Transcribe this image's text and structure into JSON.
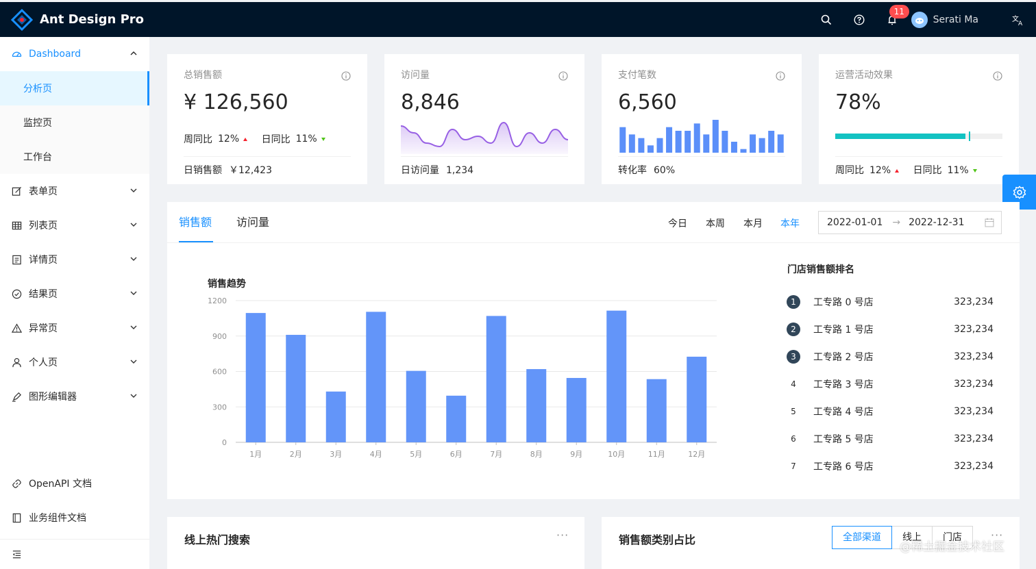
{
  "header": {
    "title": "Ant Design Pro",
    "notification_count": "11",
    "user_name": "Serati Ma",
    "lang_glyph": "文A"
  },
  "sider": {
    "dashboard": {
      "label": "Dashboard",
      "children": [
        "分析页",
        "监控页",
        "工作台"
      ]
    },
    "items": [
      "表单页",
      "列表页",
      "详情页",
      "结果页",
      "异常页",
      "个人页",
      "图形编辑器"
    ],
    "bottom": [
      "OpenAPI 文档",
      "业务组件文档"
    ]
  },
  "stats": [
    {
      "title": "总销售额",
      "value": "¥ 126,560",
      "foot_label": "日销售额",
      "foot_value": "￥12,423",
      "trends": [
        {
          "label": "周同比",
          "value": "12%",
          "dir": "up"
        },
        {
          "label": "日同比",
          "value": "11%",
          "dir": "down"
        }
      ]
    },
    {
      "title": "访问量",
      "value": "8,846",
      "foot_label": "日访问量",
      "foot_value": "1,234",
      "area_values": [
        7,
        5,
        2,
        1,
        6,
        3,
        4,
        2,
        8,
        1,
        5,
        2,
        6,
        3
      ]
    },
    {
      "title": "支付笔数",
      "value": "6,560",
      "foot_label": "转化率",
      "foot_value": "60%",
      "bar_values": [
        7,
        5,
        4,
        2,
        4,
        7,
        6,
        6,
        8,
        5,
        9,
        6,
        3,
        1,
        5,
        4,
        6,
        5
      ]
    },
    {
      "title": "运营活动效果",
      "value": "78%",
      "progress": 78,
      "target": 80,
      "trends": [
        {
          "label": "周同比",
          "value": "12%",
          "dir": "up"
        },
        {
          "label": "日同比",
          "value": "11%",
          "dir": "down"
        }
      ]
    }
  ],
  "sales": {
    "tabs": [
      "销售额",
      "访问量"
    ],
    "ranges": [
      "今日",
      "本周",
      "本月",
      "本年"
    ],
    "active_range": "本年",
    "date_start": "2022-01-01",
    "date_end": "2022-12-31",
    "chart_title": "销售趋势",
    "rank_title": "门店销售额排名",
    "rank": [
      {
        "no": "1",
        "name": "工专路 0 号店",
        "value": "323,234"
      },
      {
        "no": "2",
        "name": "工专路 1 号店",
        "value": "323,234"
      },
      {
        "no": "3",
        "name": "工专路 2 号店",
        "value": "323,234"
      },
      {
        "no": "4",
        "name": "工专路 3 号店",
        "value": "323,234"
      },
      {
        "no": "5",
        "name": "工专路 4 号店",
        "value": "323,234"
      },
      {
        "no": "6",
        "name": "工专路 5 号店",
        "value": "323,234"
      },
      {
        "no": "7",
        "name": "工专路 6 号店",
        "value": "323,234"
      }
    ]
  },
  "chart_data": {
    "type": "bar",
    "title": "销售趋势",
    "categories": [
      "1月",
      "2月",
      "3月",
      "4月",
      "5月",
      "6月",
      "7月",
      "8月",
      "9月",
      "10月",
      "11月",
      "12月"
    ],
    "values": [
      1095,
      910,
      430,
      1105,
      605,
      395,
      1070,
      620,
      545,
      1115,
      535,
      725
    ],
    "ylim": [
      0,
      1200
    ],
    "yticks": [
      0,
      300,
      600,
      900,
      1200
    ],
    "color": "#6395f9",
    "grid": true
  },
  "bottom": {
    "search_title": "线上热门搜索",
    "category_title": "销售额类别占比",
    "channels": [
      "全部渠道",
      "线上",
      "门店"
    ],
    "more": "···",
    "watermark": "@稀土掘金技术社区"
  },
  "colors": {
    "primary": "#1890ff",
    "header_bg": "#001529",
    "progress": "#13c2c2",
    "area": "#975fe4"
  }
}
